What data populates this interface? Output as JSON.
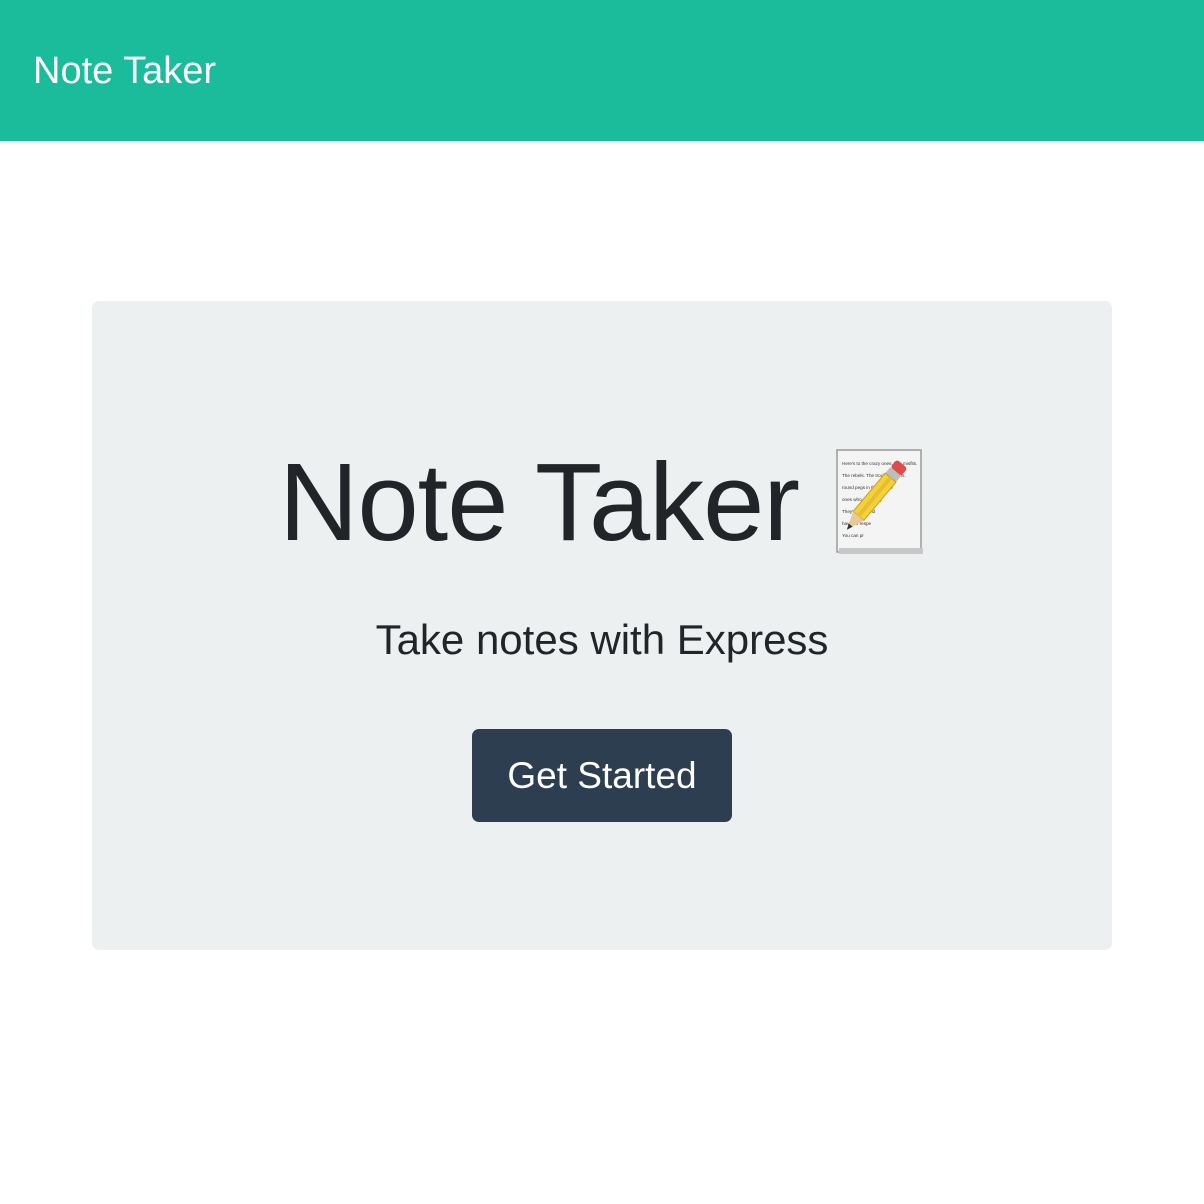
{
  "navbar": {
    "brand": "Note Taker",
    "background": "#1abc9c"
  },
  "hero": {
    "title": "Note Taker",
    "title_icon": "memo-icon",
    "subtitle": "Take notes with Express",
    "memo_lines": [
      "Here's to the crazy ones. The misfits.",
      "The rebels. The troublemakers.",
      "round pegs in the square",
      "ones who see thing",
      "They're not fond",
      "have no respe",
      "You can pr"
    ],
    "background": "#ecf0f1"
  },
  "cta": {
    "label": "Get Started",
    "background": "#2c3e50"
  }
}
